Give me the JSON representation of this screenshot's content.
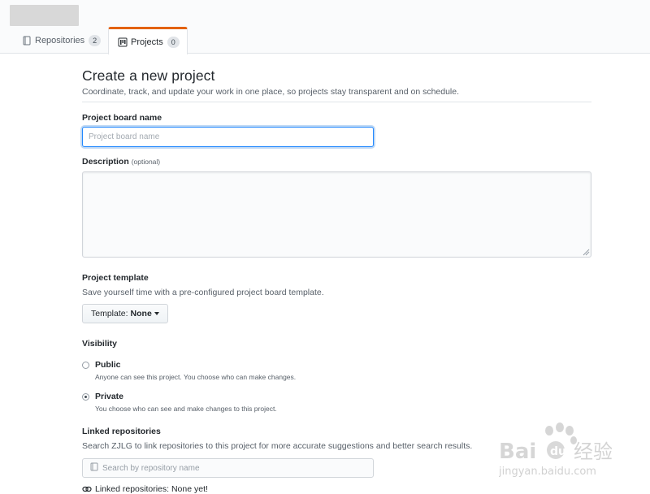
{
  "header": {
    "tabs": [
      {
        "label": "Repositories",
        "count": "2",
        "icon": "repo-icon"
      },
      {
        "label": "Projects",
        "count": "0",
        "icon": "project-icon",
        "selected": true
      }
    ]
  },
  "page": {
    "title": "Create a new project",
    "subtitle": "Coordinate, track, and update your work in one place, so projects stay transparent and on schedule."
  },
  "form": {
    "name_label": "Project board name",
    "name_placeholder": "Project board name",
    "name_value": "",
    "description_label": "Description",
    "description_optional": "(optional)",
    "description_value": "",
    "template_label": "Project template",
    "template_note": "Save yourself time with a pre-configured project board template.",
    "template_button_prefix": "Template:",
    "template_button_value": "None",
    "visibility_label": "Visibility",
    "visibility_options": [
      {
        "title": "Public",
        "note": "Anyone can see this project. You choose who can make changes.",
        "checked": false
      },
      {
        "title": "Private",
        "note": "You choose who can see and make changes to this project.",
        "checked": true
      }
    ],
    "linked_label": "Linked repositories",
    "linked_note": "Search ZJLG to link repositories to this project for more accurate suggestions and better search results.",
    "repo_search_placeholder": "Search by repository name",
    "linked_status": "Linked repositories: None yet!"
  },
  "watermark": {
    "brand": "Baidu",
    "brand_cn": "经验",
    "url": "jingyan.baidu.com"
  },
  "colors": {
    "accent": "#e36209",
    "focus": "#2188ff",
    "text": "#24292e",
    "muted": "#586069"
  }
}
